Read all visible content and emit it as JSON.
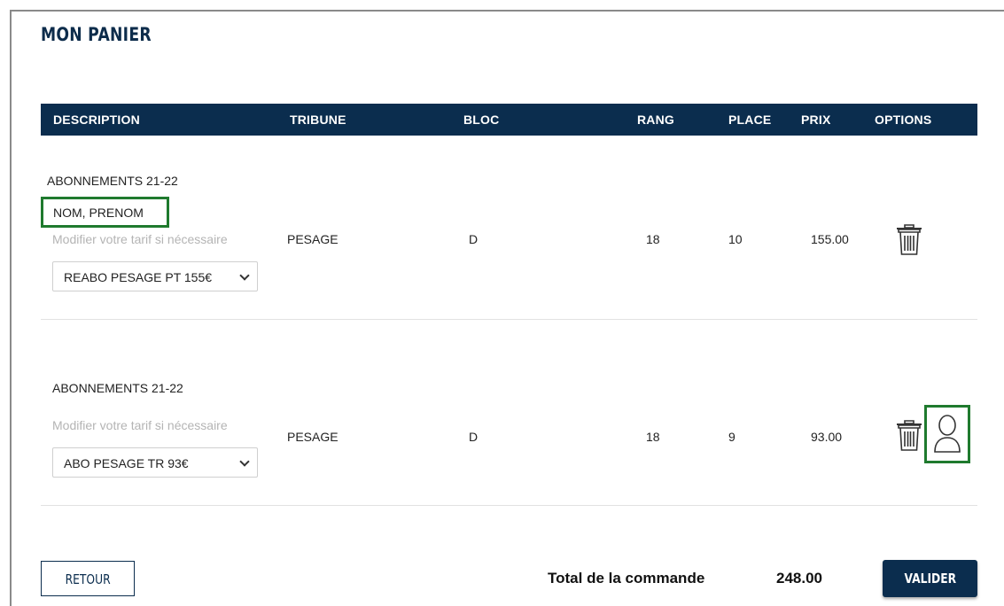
{
  "page": {
    "title": "MON PANIER"
  },
  "table": {
    "headers": {
      "description": "DESCRIPTION",
      "tribune": "TRIBUNE",
      "bloc": "BLOC",
      "rang": "RANG",
      "place": "PLACE",
      "prix": "PRIX",
      "options": "OPTIONS"
    },
    "rows": [
      {
        "title": "ABONNEMENTS 21-22",
        "holder_name": "NOM, PRENOM",
        "tarif_hint": "Modifier votre tarif si nécessaire",
        "tarif_selected": "REABO PESAGE PT 155€",
        "tribune": "PESAGE",
        "bloc": "D",
        "rang": "18",
        "place": "10",
        "prix": "155.00",
        "options": [
          "trash-icon"
        ]
      },
      {
        "title": "ABONNEMENTS 21-22",
        "tarif_hint": "Modifier votre tarif si nécessaire",
        "tarif_selected": "ABO PESAGE TR 93€",
        "tribune": "PESAGE",
        "bloc": "D",
        "rang": "18",
        "place": "9",
        "prix": "93.00",
        "options": [
          "trash-icon",
          "user-icon"
        ]
      }
    ]
  },
  "footer": {
    "back_label": "RETOUR",
    "total_label": "Total de la commande",
    "total_value": "248.00",
    "validate_label": "VALIDER"
  },
  "colors": {
    "header_bg": "#0b2d4e",
    "title": "#0d2c4b",
    "highlight": "#1f7a2e"
  }
}
